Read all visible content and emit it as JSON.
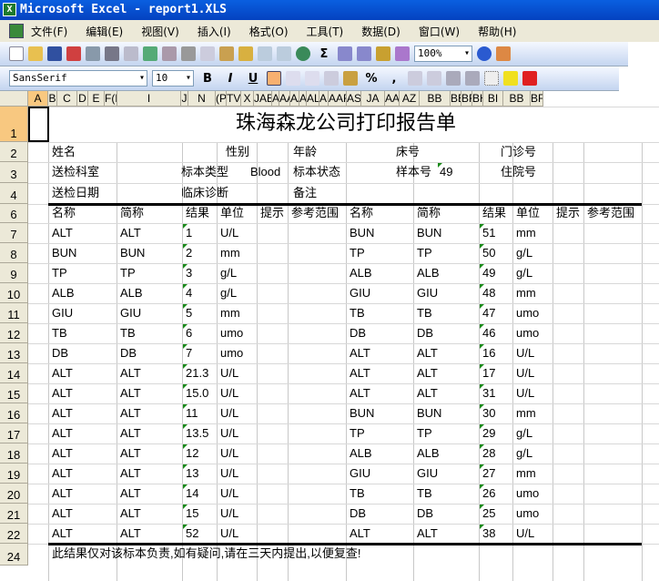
{
  "window": {
    "title": "Microsoft Excel - report1.XLS"
  },
  "menu": [
    "文件(F)",
    "编辑(E)",
    "视图(V)",
    "插入(I)",
    "格式(O)",
    "工具(T)",
    "数据(D)",
    "窗口(W)",
    "帮助(H)"
  ],
  "toolbar": {
    "zoom": "100%",
    "font": "SansSerif",
    "font_size": "10",
    "bold": "B",
    "italic": "I",
    "underline": "U",
    "percent": "%",
    "comma": ","
  },
  "columns": [
    "A",
    "B",
    "C",
    "D",
    "E",
    "F(H",
    "I",
    "J",
    "N",
    "(PQR",
    "TVW",
    "X",
    "JAE",
    "AAA",
    "AAI",
    "AA",
    "AK",
    "AL",
    "AM",
    "AAR",
    "AS",
    "JA",
    "AAA",
    "AZ",
    "BB",
    "BB",
    "BR",
    "BH",
    "BI",
    "BB",
    "BF"
  ],
  "report": {
    "title": "珠海森龙公司打印报告单",
    "info": [
      [
        {
          "t": "姓名"
        },
        {
          "t": "性别"
        },
        {
          "t": "年龄"
        },
        {
          "t": "床号"
        },
        {
          "t": "门诊号"
        }
      ],
      [
        {
          "t": "送检科室"
        },
        {
          "t": "标本类型"
        },
        {
          "t": "Blood"
        },
        {
          "t": "标本状态"
        },
        {
          "t": "样本号"
        },
        {
          "t": "49"
        },
        {
          "t": "住院号"
        }
      ],
      [
        {
          "t": "送检日期"
        },
        {
          "t": "临床诊断"
        },
        {
          "t": "备注"
        }
      ]
    ],
    "headers": [
      "名称",
      "简称",
      "结果",
      "单位",
      "提示",
      "参考范围",
      "名称",
      "简称",
      "结果",
      "单位",
      "提示",
      "参考范围"
    ],
    "rows": [
      [
        "ALT",
        "ALT",
        "1",
        "U/L",
        "BUN",
        "BUN",
        "51",
        "mm"
      ],
      [
        "BUN",
        "BUN",
        "2",
        "mm",
        "TP",
        "TP",
        "50",
        "g/L"
      ],
      [
        "TP",
        "TP",
        "3",
        "g/L",
        "ALB",
        "ALB",
        "49",
        "g/L"
      ],
      [
        "ALB",
        "ALB",
        "4",
        "g/L",
        "GIU",
        "GIU",
        "48",
        "mm"
      ],
      [
        "GIU",
        "GIU",
        "5",
        "mm",
        "TB",
        "TB",
        "47",
        "umo"
      ],
      [
        "TB",
        "TB",
        "6",
        "umo",
        "DB",
        "DB",
        "46",
        "umo"
      ],
      [
        "DB",
        "DB",
        "7",
        "umo",
        "ALT",
        "ALT",
        "16",
        "U/L"
      ],
      [
        "ALT",
        "ALT",
        "21.3",
        "U/L",
        "ALT",
        "ALT",
        "17",
        "U/L"
      ],
      [
        "ALT",
        "ALT",
        "15.0",
        "U/L",
        "ALT",
        "ALT",
        "31",
        "U/L"
      ],
      [
        "ALT",
        "ALT",
        "11",
        "U/L",
        "BUN",
        "BUN",
        "30",
        "mm"
      ],
      [
        "ALT",
        "ALT",
        "13.5",
        "U/L",
        "TP",
        "TP",
        "29",
        "g/L"
      ],
      [
        "ALT",
        "ALT",
        "12",
        "U/L",
        "ALB",
        "ALB",
        "28",
        "g/L"
      ],
      [
        "ALT",
        "ALT",
        "13",
        "U/L",
        "GIU",
        "GIU",
        "27",
        "mm"
      ],
      [
        "ALT",
        "ALT",
        "14",
        "U/L",
        "TB",
        "TB",
        "26",
        "umo"
      ],
      [
        "ALT",
        "ALT",
        "15",
        "U/L",
        "DB",
        "DB",
        "25",
        "umo"
      ],
      [
        "ALT",
        "ALT",
        "52",
        "U/L",
        "ALT",
        "ALT",
        "38",
        "U/L"
      ]
    ],
    "row_numbers": [
      "1",
      "2",
      "3",
      "4",
      "6",
      "7",
      "8",
      "9",
      "10",
      "11",
      "12",
      "13",
      "14",
      "15",
      "16",
      "17",
      "18",
      "19",
      "20",
      "21",
      "22",
      "24"
    ],
    "footer": "此结果仅对该标本负责,如有疑问,请在三天内提出,以便复查!"
  }
}
